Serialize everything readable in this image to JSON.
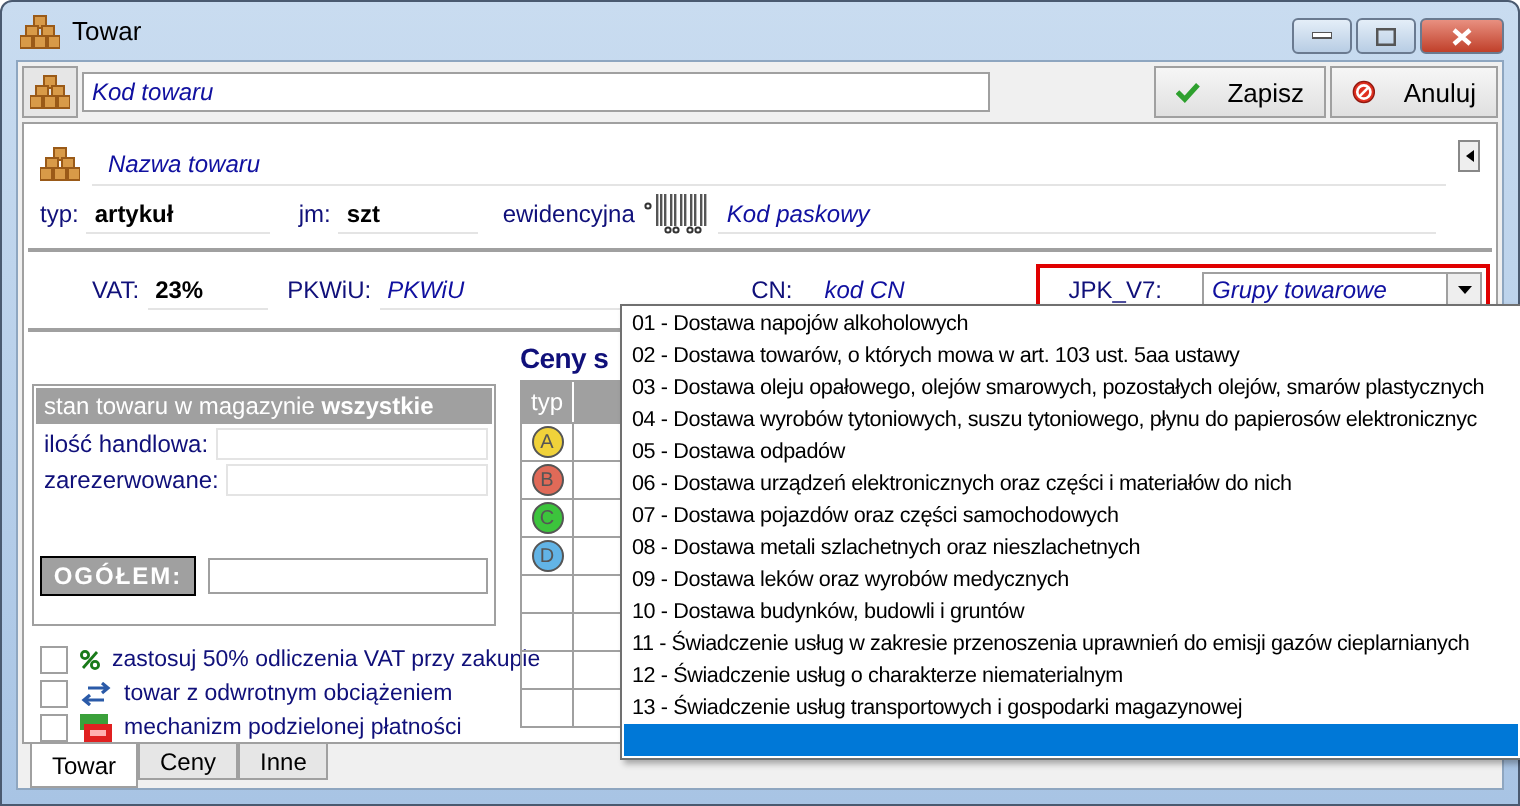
{
  "window": {
    "title": "Towar"
  },
  "toolbar": {
    "code_field": {
      "placeholder": "Kod towaru"
    },
    "buttons": [
      {
        "label": "Zapisz",
        "kind": "save"
      },
      {
        "label": "Anuluj",
        "kind": "cancel"
      }
    ]
  },
  "header": {
    "name_field": {
      "placeholder": "Nazwa towaru"
    },
    "type": {
      "label": "typ:",
      "value": "artykuł"
    },
    "unit": {
      "label": "jm:",
      "value": "szt"
    },
    "barcode": {
      "label": "ewidencyjna",
      "placeholder": "Kod paskowy"
    }
  },
  "tax": {
    "vat": {
      "label": "VAT:",
      "value": "23%"
    },
    "pkwiu": {
      "label": "PKWiU:",
      "placeholder": "PKWiU"
    },
    "cn": {
      "label": "CN:",
      "placeholder": "kod CN"
    },
    "jpk": {
      "label": "JPK_V7:",
      "placeholder": "Grupy towarowe",
      "expanded": true
    }
  },
  "stock": {
    "title": "stan towaru w magazynie **wszystkie**",
    "fields": [
      "ilość handlowa:",
      "zarezerwowane:"
    ],
    "total_label": "OGÓŁEM:"
  },
  "options": [
    {
      "label": "zastosuj 50% odliczenia VAT przy zakupie",
      "checked": false,
      "kind": "percent"
    },
    {
      "label": "towar z odwrotnym obciążeniem",
      "checked": false,
      "kind": "arrows"
    },
    {
      "label": "mechanizm podzielonej płatności",
      "checked": false,
      "kind": "split"
    }
  ],
  "prices": {
    "title": "Ceny s",
    "columns": [
      "typ"
    ],
    "rows": [
      {
        "label": "A",
        "color": "#f0d23a"
      },
      {
        "label": "B",
        "color": "#e06a58"
      },
      {
        "label": "C",
        "color": "#3cc43c"
      },
      {
        "label": "D",
        "color": "#62b4e6"
      }
    ]
  },
  "dropdown": {
    "items": [
      {
        "label": "01 - Dostawa napojów alkoholowych",
        "selected": false
      },
      {
        "label": "02 - Dostawa towarów, o których mowa w art. 103 ust. 5aa ustawy",
        "selected": false
      },
      {
        "label": "03 - Dostawa oleju opałowego, olejów smarowych, pozostałych olejów, smarów plastycznych",
        "selected": false
      },
      {
        "label": "04 - Dostawa wyrobów tytoniowych, suszu tytoniowego, płynu do papierosów elektronicznyc",
        "selected": false
      },
      {
        "label": "05 - Dostawa odpadów",
        "selected": false
      },
      {
        "label": "06 - Dostawa urządzeń elektronicznych oraz części i materiałów do nich",
        "selected": false
      },
      {
        "label": "07 - Dostawa pojazdów oraz części samochodowych",
        "selected": false
      },
      {
        "label": "08 - Dostawa metali szlachetnych oraz nieszlachetnych",
        "selected": false
      },
      {
        "label": "09 - Dostawa leków oraz wyrobów medycznych",
        "selected": false
      },
      {
        "label": "10 - Dostawa budynków, budowli i gruntów",
        "selected": false
      },
      {
        "label": "11 - Świadczenie usług w zakresie przenoszenia uprawnień do emisji gazów cieplarnianych",
        "selected": false
      },
      {
        "label": "12 - Świadczenie usług o charakterze niematerialnym",
        "selected": false
      },
      {
        "label": "13 - Świadczenie usług transportowych i gospodarki magazynowej",
        "selected": false
      },
      {
        "selected": true
      }
    ]
  },
  "tabs": [
    {
      "label": "Towar",
      "selected": true
    },
    {
      "label": "Ceny",
      "selected": false
    },
    {
      "label": "Inne",
      "selected": false
    }
  ]
}
